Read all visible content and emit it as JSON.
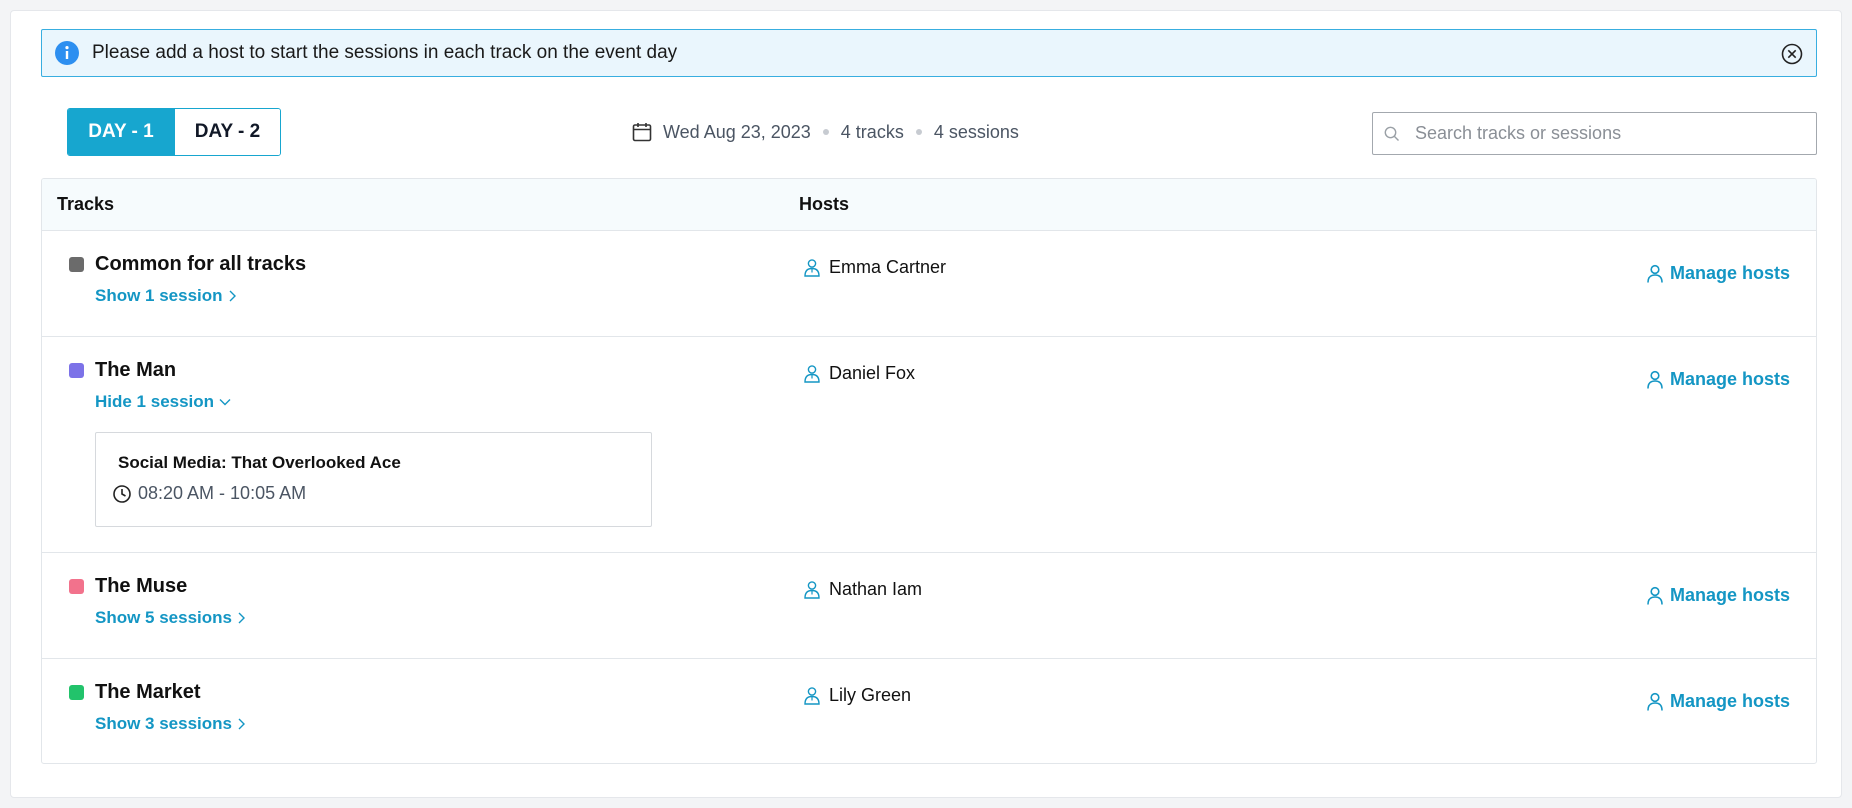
{
  "banner": {
    "message": "Please add a host to start the sessions in each track on the event day",
    "info_icon": "info-icon",
    "close_icon": "close-circle-icon"
  },
  "days": [
    {
      "label": "DAY - 1",
      "active": true
    },
    {
      "label": "DAY - 2",
      "active": false
    }
  ],
  "meta": {
    "date": "Wed Aug 23, 2023",
    "tracks": "4 tracks",
    "sessions": "4 sessions"
  },
  "search": {
    "placeholder": "Search tracks or sessions",
    "value": ""
  },
  "table": {
    "headers": {
      "tracks": "Tracks",
      "hosts": "Hosts"
    },
    "manage_label": "Manage hosts",
    "rows": [
      {
        "name": "Common for all tracks",
        "color": "#6b6b6b",
        "toggle": "Show 1 session",
        "expanded": false,
        "host": "Emma Cartner"
      },
      {
        "name": "The Man",
        "color": "#7c72e8",
        "toggle": "Hide 1 session",
        "expanded": true,
        "host": "Daniel Fox",
        "session": {
          "title": "Social Media: That Overlooked Ace",
          "time": "08:20 AM - 10:05 AM"
        }
      },
      {
        "name": "The Muse",
        "color": "#f2728c",
        "toggle": "Show 5 sessions",
        "expanded": false,
        "host": "Nathan Iam"
      },
      {
        "name": "The Market",
        "color": "#22c36b",
        "toggle": "Show 3 sessions",
        "expanded": false,
        "host": "Lily Green"
      }
    ]
  },
  "colors": {
    "accent": "#17a6cf",
    "link": "#1496c4",
    "banner_bg": "#eaf6fd"
  }
}
